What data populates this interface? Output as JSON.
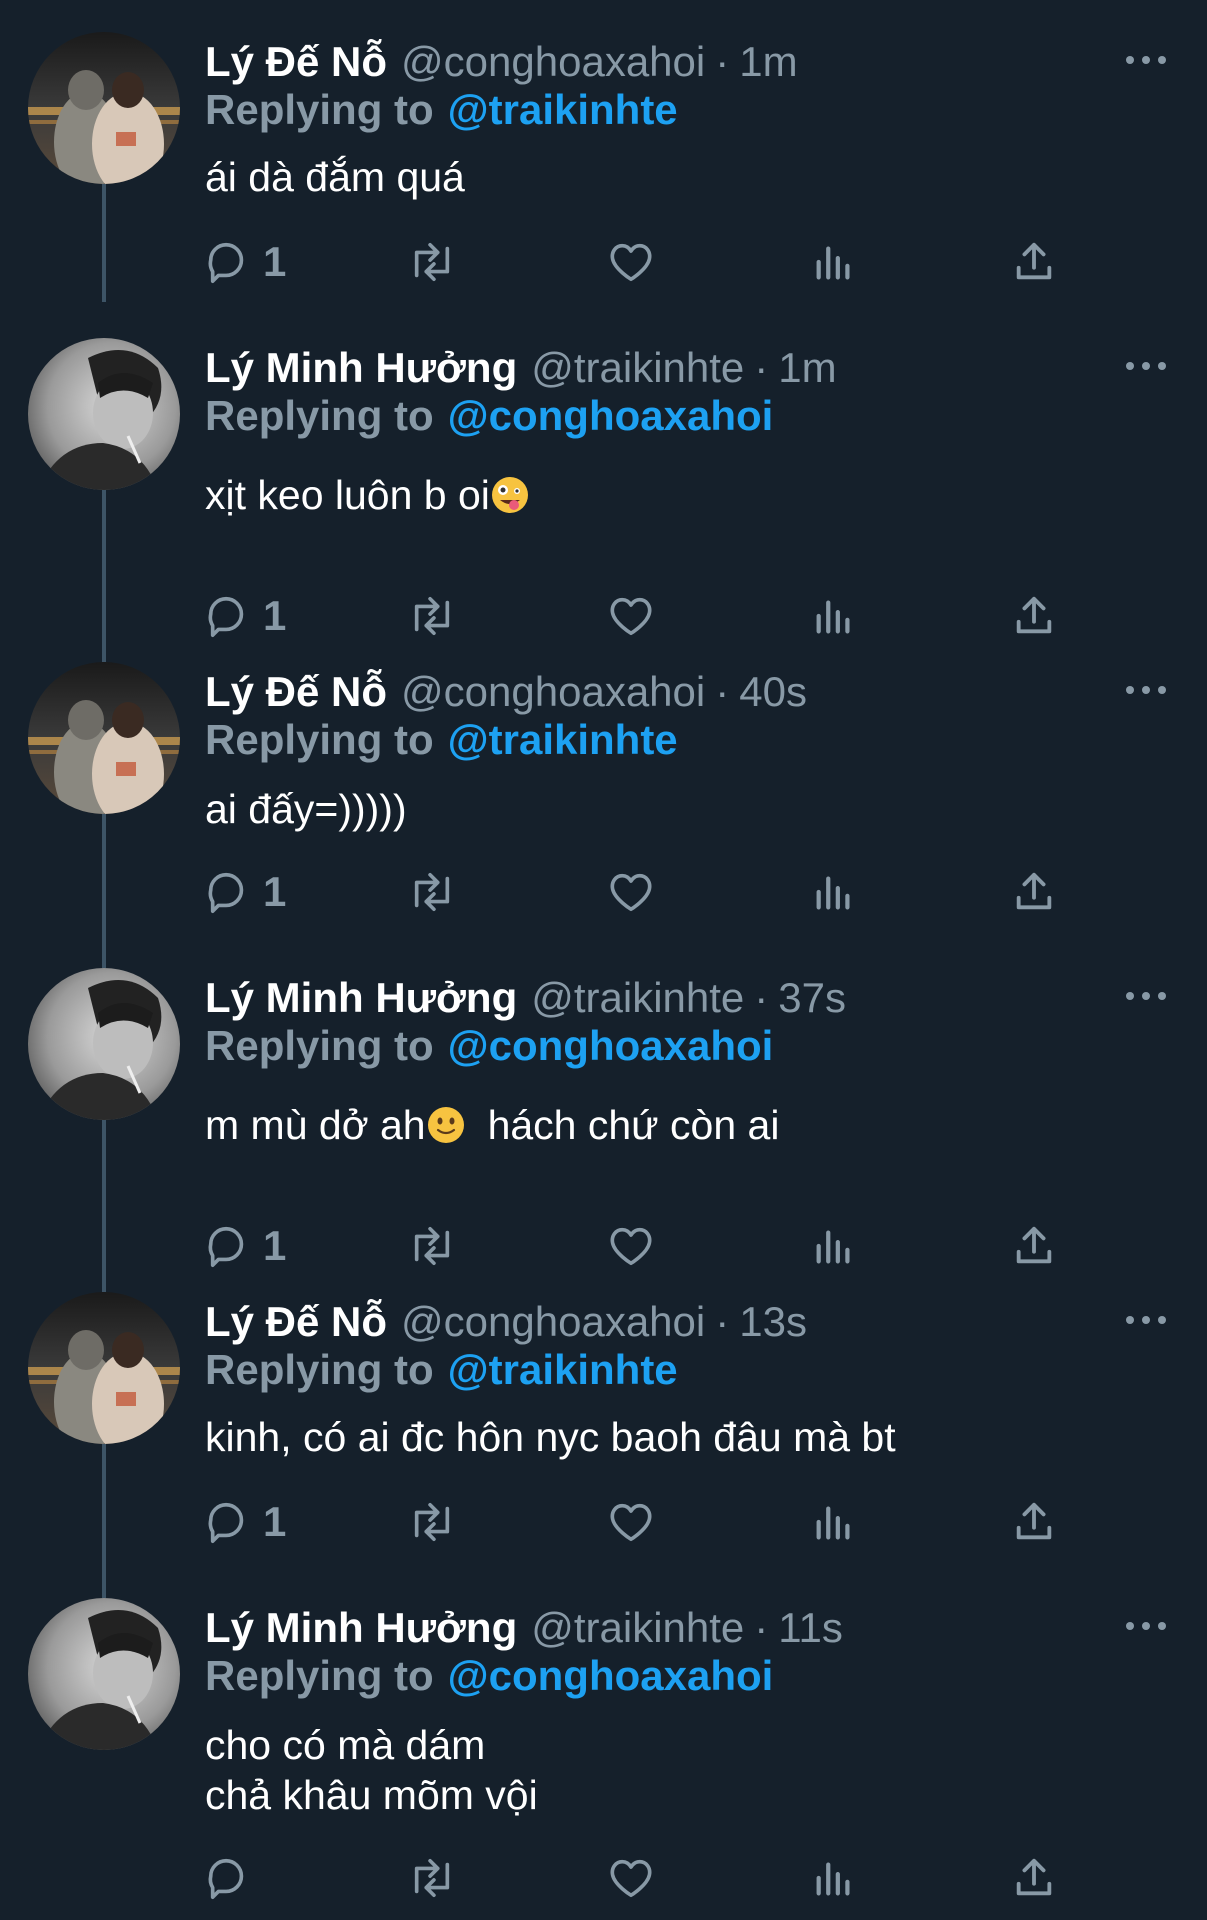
{
  "colors": {
    "background": "#15202b",
    "muted": "#8899a6",
    "link": "#1da1f2",
    "thread_line": "#3d5466"
  },
  "tweets": [
    {
      "name": "Lý Đế Nỗ",
      "handle": "@conghoaxahoi",
      "time": "1m",
      "reply_label": "Replying to",
      "reply_to": "@traikinhte",
      "text": "ái dà đắm quá",
      "reply_count": "1",
      "avatar": "avatar-photo-couple"
    },
    {
      "name": "Lý Minh Hưởng",
      "handle": "@traikinhte",
      "time": "1m",
      "reply_label": "Replying to",
      "reply_to": "@conghoaxahoi",
      "text": "xịt keo luôn b oi",
      "emoji": "zany-face",
      "reply_count": "1",
      "avatar": "avatar-photo-bw"
    },
    {
      "name": "Lý Đế Nỗ",
      "handle": "@conghoaxahoi",
      "time": "40s",
      "reply_label": "Replying to",
      "reply_to": "@traikinhte",
      "text": "ai đấy=)))))",
      "reply_count": "1",
      "avatar": "avatar-photo-couple"
    },
    {
      "name": "Lý Minh Hưởng",
      "handle": "@traikinhte",
      "time": "37s",
      "reply_label": "Replying to",
      "reply_to": "@conghoaxahoi",
      "text_before": "m mù dở ah",
      "emoji": "slightly-smiling-face",
      "text_after": "hách chứ còn ai",
      "reply_count": "1",
      "avatar": "avatar-photo-bw"
    },
    {
      "name": "Lý Đế Nỗ",
      "handle": "@conghoaxahoi",
      "time": "13s",
      "reply_label": "Replying to",
      "reply_to": "@traikinhte",
      "text": "kinh, có ai đc hôn nyc baoh đâu mà bt",
      "reply_count": "1",
      "avatar": "avatar-photo-couple"
    },
    {
      "name": "Lý Minh Hưởng",
      "handle": "@traikinhte",
      "time": "11s",
      "reply_label": "Replying to",
      "reply_to": "@conghoaxahoi",
      "text_line1": "cho có mà dám",
      "text_line2": "chả khâu mõm vội",
      "reply_count": "",
      "avatar": "avatar-photo-bw"
    }
  ],
  "action_icons": [
    "reply-icon",
    "retweet-icon",
    "like-icon",
    "analytics-icon",
    "share-icon"
  ]
}
